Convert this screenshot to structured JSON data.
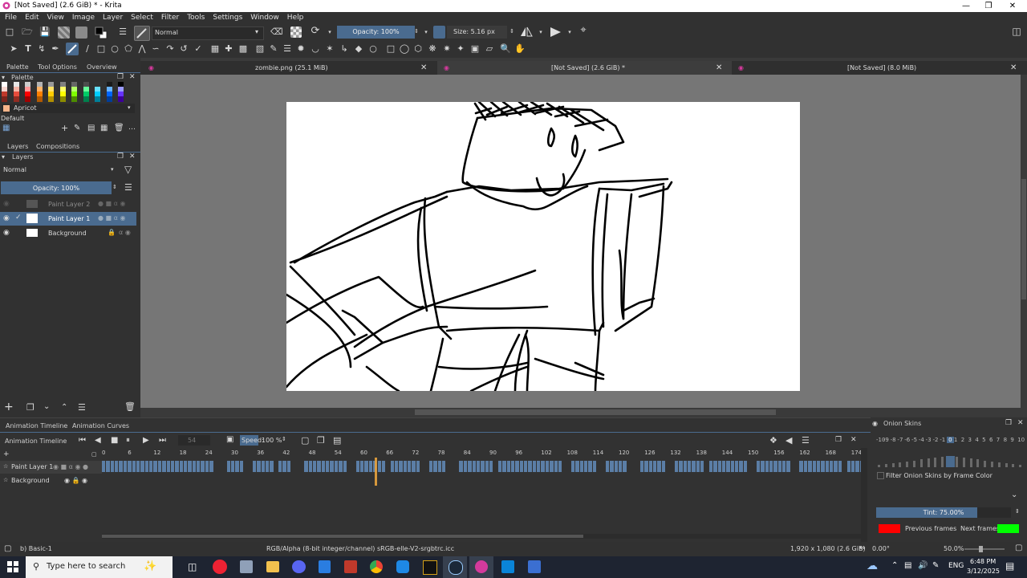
{
  "window": {
    "title": "[Not Saved]  (2.6 GiB) * - Krita"
  },
  "menu": [
    "File",
    "Edit",
    "View",
    "Image",
    "Layer",
    "Select",
    "Filter",
    "Tools",
    "Settings",
    "Window",
    "Help"
  ],
  "toolbar": {
    "blend_mode": "Normal",
    "opacity": "Opacity: 100%",
    "size": "Size: 5.16 px"
  },
  "left_tabs": [
    "Palette",
    "Tool Options",
    "Overview"
  ],
  "palette": {
    "title": "Palette",
    "color_name": "Apricot",
    "set_name": "Default",
    "colors": [
      "#ffffff",
      "#e6e6e6",
      "#cccccc",
      "#b3b3b3",
      "#999999",
      "#808080",
      "#666666",
      "#4d4d4d",
      "#333333",
      "#1a1a1a",
      "#000000",
      "#f8d7d0",
      "#f4b4a6",
      "#ff9999",
      "#ffb366",
      "#ffe066",
      "#ffff66",
      "#b3ff66",
      "#66ff99",
      "#66e0ff",
      "#66b3ff",
      "#9999ff",
      "#c0392b",
      "#e74c3c",
      "#ff0000",
      "#ff8000",
      "#ffcc00",
      "#ffff00",
      "#80ff00",
      "#00cc66",
      "#00ccff",
      "#0066ff",
      "#6633ff",
      "#7b241c",
      "#922b21",
      "#a00000",
      "#b35900",
      "#b38f00",
      "#8c8c00",
      "#4d8c00",
      "#00804d",
      "#008099",
      "#003d99",
      "#3d0099"
    ]
  },
  "layers_tabs": [
    "Layers",
    "Compositions"
  ],
  "layers": {
    "title": "Layers",
    "mode": "Normal",
    "opacity": "Opacity:  100%",
    "items": [
      {
        "name": "Paint Layer 2"
      },
      {
        "name": "Paint Layer 1"
      },
      {
        "name": "Background"
      }
    ]
  },
  "doc_tabs": [
    {
      "label": "zombie.png (25.1 MiB)"
    },
    {
      "label": "[Not Saved]  (2.6 GiB) *"
    },
    {
      "label": "[Not Saved]  (8.0 MiB)"
    }
  ],
  "timeline": {
    "tabs": [
      "Animation Timeline",
      "Animation Curves"
    ],
    "title": "Animation Timeline",
    "frame": "54",
    "speed_label": "Speed:",
    "speed": "100 %",
    "ruler": [
      "0",
      "6",
      "12",
      "18",
      "24",
      "30",
      "36",
      "42",
      "48",
      "54",
      "60",
      "66",
      "72",
      "78",
      "84",
      "90",
      "96",
      "102",
      "108",
      "114",
      "120",
      "126",
      "132",
      "138",
      "144",
      "150",
      "156",
      "162",
      "168",
      "174"
    ],
    "layers": [
      "Paint Layer 1",
      "Background"
    ]
  },
  "onion": {
    "title": "Onion Skins",
    "numbers": [
      "-10",
      "-9",
      "-8",
      "-7",
      "-6",
      "-5",
      "-4",
      "-3",
      "-2",
      "-1",
      "0",
      "1",
      "2",
      "3",
      "4",
      "5",
      "6",
      "7",
      "8",
      "9",
      "10"
    ],
    "filter_label": "Filter Onion Skins by Frame Color",
    "tint": "Tint: 75.00%",
    "tint_fraction": 0.75,
    "prev_label": "Previous frames",
    "next_label": "Next frames",
    "prev_color": "#ff0000",
    "next_color": "#00ff00"
  },
  "status": {
    "brush": "b) Basic-1",
    "color_model": "RGB/Alpha (8-bit integer/channel)  sRGB-elle-V2-srgbtrc.icc",
    "image_size": "1,920 x 1,080 (2.6 GiB)",
    "rotation": "0.00°",
    "zoom": "50.0%"
  },
  "taskbar": {
    "search_placeholder": "Type here to search",
    "lang": "ENG",
    "time": "6:48 PM",
    "date": "3/12/2025"
  }
}
